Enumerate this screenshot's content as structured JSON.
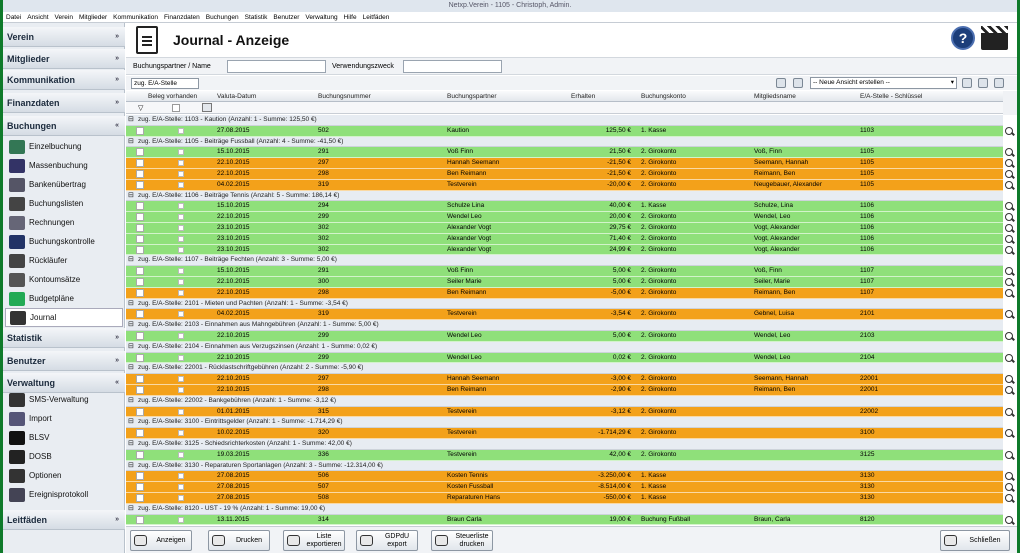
{
  "window": {
    "title": "Netxp.Verein - 1105 - Christoph, Admin."
  },
  "menu": [
    "Datei",
    "Ansicht",
    "Verein",
    "Mitglieder",
    "Kommunikation",
    "Finanzdaten",
    "Buchungen",
    "Statistik",
    "Benutzer",
    "Verwaltung",
    "Hilfe",
    "Leitfäden"
  ],
  "sidebar": {
    "sections": [
      "Verein",
      "Mitglieder",
      "Kommunikation",
      "Finanzdaten",
      "Buchungen",
      "Statistik",
      "Benutzer",
      "Verwaltung",
      "Leitfäden"
    ],
    "buchungen_items": [
      "Einzelbuchung",
      "Massenbuchung",
      "Bankenübertrag",
      "Buchungslisten",
      "Rechnungen",
      "Buchungskontrolle",
      "Rückläufer",
      "Kontoumsätze",
      "Budgetpläne",
      "Journal"
    ],
    "verwaltung_items": [
      "SMS-Verwaltung",
      "Import",
      "BLSV",
      "DOSB",
      "Optionen",
      "Ereignisprotokoll"
    ]
  },
  "header": {
    "title": "Journal - Anzeige",
    "help": "?"
  },
  "filter": {
    "partner_label": "Buchungspartner / Name",
    "purpose_label": "Verwendungszweck",
    "partner_value": "",
    "purpose_value": ""
  },
  "toolbar": {
    "group_field": "zug. E/A-Stelle",
    "view_select": "-- Neue Ansicht erstellen --"
  },
  "columns": [
    "Beleg vorhanden",
    "Valuta-Datum",
    "Buchungsnummer",
    "Buchungspartner",
    "Erhalten",
    "Buchungskonto",
    "Mitgliedsname",
    "E/A-Stelle - Schlüssel"
  ],
  "groups": [
    {
      "label": "zug. E/A-Stelle:  1103 - Kaution (Anzahl: 1  - Summe: 125,50 €)",
      "rows": [
        {
          "c": "green",
          "d": "27.08.2015",
          "n": "502",
          "p": "Kaution",
          "e": "125,50 €",
          "k": "1. Kasse",
          "m": "",
          "s": "1103"
        }
      ]
    },
    {
      "label": "zug. E/A-Stelle:  1105 - Beiträge Fussball (Anzahl: 4  - Summe: -41,50 €)",
      "rows": [
        {
          "c": "green",
          "d": "15.10.2015",
          "n": "291",
          "p": "Voß Finn",
          "e": "21,50 €",
          "k": "2. Girokonto",
          "m": "Voß, Finn",
          "s": "1105"
        },
        {
          "c": "orange",
          "d": "22.10.2015",
          "n": "297",
          "p": "Hannah Seemann",
          "e": "-21,50 €",
          "k": "2. Girokonto",
          "m": "Seemann, Hannah",
          "s": "1105"
        },
        {
          "c": "orange",
          "d": "22.10.2015",
          "n": "298",
          "p": "Ben Reimann",
          "e": "-21,50 €",
          "k": "2. Girokonto",
          "m": "Reimann, Ben",
          "s": "1105"
        },
        {
          "c": "orange",
          "d": "04.02.2015",
          "n": "319",
          "p": "Testverein",
          "e": "-20,00 €",
          "k": "2. Girokonto",
          "m": "Neugebauer, Alexander",
          "s": "1105"
        }
      ]
    },
    {
      "label": "zug. E/A-Stelle:  1106 - Beiträge Tennis (Anzahl: 5  - Summe: 186,14 €)",
      "rows": [
        {
          "c": "green",
          "d": "15.10.2015",
          "n": "294",
          "p": "Schulze Lina",
          "e": "40,00 €",
          "k": "1. Kasse",
          "m": "Schulze, Lina",
          "s": "1106"
        },
        {
          "c": "green",
          "d": "22.10.2015",
          "n": "299",
          "p": "Wendel Leo",
          "e": "20,00 €",
          "k": "2. Girokonto",
          "m": "Wendel, Leo",
          "s": "1106"
        },
        {
          "c": "green",
          "d": "23.10.2015",
          "n": "302",
          "p": "Alexander Vogt",
          "e": "29,75 €",
          "k": "2. Girokonto",
          "m": "Vogt, Alexander",
          "s": "1106"
        },
        {
          "c": "green",
          "d": "23.10.2015",
          "n": "302",
          "p": "Alexander Vogt",
          "e": "71,40 €",
          "k": "2. Girokonto",
          "m": "Vogt, Alexander",
          "s": "1106"
        },
        {
          "c": "green",
          "d": "23.10.2015",
          "n": "302",
          "p": "Alexander Vogt",
          "e": "24,99 €",
          "k": "2. Girokonto",
          "m": "Vogt, Alexander",
          "s": "1106"
        }
      ]
    },
    {
      "label": "zug. E/A-Stelle:  1107 - Beiträge Fechten (Anzahl: 3  - Summe: 5,00 €)",
      "rows": [
        {
          "c": "green",
          "d": "15.10.2015",
          "n": "291",
          "p": "Voß Finn",
          "e": "5,00 €",
          "k": "2. Girokonto",
          "m": "Voß, Finn",
          "s": "1107"
        },
        {
          "c": "green",
          "d": "22.10.2015",
          "n": "300",
          "p": "Seiler Marie",
          "e": "5,00 €",
          "k": "2. Girokonto",
          "m": "Seiler, Marie",
          "s": "1107"
        },
        {
          "c": "orange",
          "d": "22.10.2015",
          "n": "298",
          "p": "Ben Reimann",
          "e": "-5,00 €",
          "k": "2. Girokonto",
          "m": "Reimann, Ben",
          "s": "1107"
        }
      ]
    },
    {
      "label": "zug. E/A-Stelle:  2101 - Mieten und Pachten (Anzahl: 1  - Summe: -3,54 €)",
      "rows": [
        {
          "c": "orange",
          "d": "04.02.2015",
          "n": "319",
          "p": "Testverein",
          "e": "-3,54 €",
          "k": "2. Girokonto",
          "m": "Gebnel, Luisa",
          "s": "2101"
        }
      ]
    },
    {
      "label": "zug. E/A-Stelle:  2103 - Einnahmen aus Mahngebühren (Anzahl: 1  - Summe: 5,00 €)",
      "rows": [
        {
          "c": "green",
          "d": "22.10.2015",
          "n": "299",
          "p": "Wendel Leo",
          "e": "5,00 €",
          "k": "2. Girokonto",
          "m": "Wendel, Leo",
          "s": "2103"
        }
      ]
    },
    {
      "label": "zug. E/A-Stelle:  2104 - Einnahmen aus Verzugszinsen (Anzahl: 1  - Summe: 0,02 €)",
      "rows": [
        {
          "c": "green",
          "d": "22.10.2015",
          "n": "299",
          "p": "Wendel Leo",
          "e": "0,02 €",
          "k": "2. Girokonto",
          "m": "Wendel, Leo",
          "s": "2104"
        }
      ]
    },
    {
      "label": "zug. E/A-Stelle:  22001 - Rücklastschriftgebühren (Anzahl: 2  - Summe: -5,90 €)",
      "rows": [
        {
          "c": "orange",
          "d": "22.10.2015",
          "n": "297",
          "p": "Hannah Seemann",
          "e": "-3,00 €",
          "k": "2. Girokonto",
          "m": "Seemann, Hannah",
          "s": "22001"
        },
        {
          "c": "orange",
          "d": "22.10.2015",
          "n": "298",
          "p": "Ben Reimann",
          "e": "-2,90 €",
          "k": "2. Girokonto",
          "m": "Reimann, Ben",
          "s": "22001"
        }
      ]
    },
    {
      "label": "zug. E/A-Stelle:  22002 - Bankgebühren (Anzahl: 1  - Summe: -3,12 €)",
      "rows": [
        {
          "c": "orange",
          "d": "01.01.2015",
          "n": "315",
          "p": "Testverein",
          "e": "-3,12 €",
          "k": "2. Girokonto",
          "m": "",
          "s": "22002"
        }
      ]
    },
    {
      "label": "zug. E/A-Stelle:  3100 - Eintrittsgelder (Anzahl: 1  - Summe: -1.714,29 €)",
      "rows": [
        {
          "c": "orange",
          "d": "10.02.2015",
          "n": "320",
          "p": "Testverein",
          "e": "-1.714,29 €",
          "k": "2. Girokonto",
          "m": "",
          "s": "3100"
        }
      ]
    },
    {
      "label": "zug. E/A-Stelle:  3125 - Schiedsrichterkosten (Anzahl: 1  - Summe: 42,00 €)",
      "rows": [
        {
          "c": "green",
          "d": "19.03.2015",
          "n": "336",
          "p": "Testverein",
          "e": "42,00 €",
          "k": "2. Girokonto",
          "m": "",
          "s": "3125"
        }
      ]
    },
    {
      "label": "zug. E/A-Stelle:  3130 - Reparaturen Sportanlagen (Anzahl: 3  - Summe: -12.314,00 €)",
      "rows": [
        {
          "c": "orange",
          "d": "27.08.2015",
          "n": "506",
          "p": "Kosten Tennis",
          "e": "-3.250,00 €",
          "k": "1. Kasse",
          "m": "",
          "s": "3130"
        },
        {
          "c": "orange",
          "d": "27.08.2015",
          "n": "507",
          "p": "Kosten Fussball",
          "e": "-8.514,00 €",
          "k": "1. Kasse",
          "m": "",
          "s": "3130"
        },
        {
          "c": "orange",
          "d": "27.08.2015",
          "n": "508",
          "p": "Reparaturen Hans",
          "e": "-550,00 €",
          "k": "1. Kasse",
          "m": "",
          "s": "3130"
        }
      ]
    },
    {
      "label": "zug. E/A-Stelle:  8120 - UST - 19 % (Anzahl: 1  - Summe: 19,00 €)",
      "rows": [
        {
          "c": "green",
          "d": "13.11.2015",
          "n": "314",
          "p": "Braun Carla",
          "e": "19,00 €",
          "k": "Buchung Fußball",
          "m": "Braun, Carla",
          "s": "8120"
        }
      ]
    }
  ],
  "bottom": {
    "anzeigen": "Anzeigen",
    "drucken": "Drucken",
    "liste_exportieren": "Liste exportieren",
    "gdpdu_export": "GDPdU export",
    "steuerliste_drucken": "Steuerliste drucken",
    "schliessen": "Schließen"
  },
  "colors": {
    "green_row": "#8fe07a",
    "orange_row": "#f3a11a",
    "frame": "#0f7a2a"
  }
}
